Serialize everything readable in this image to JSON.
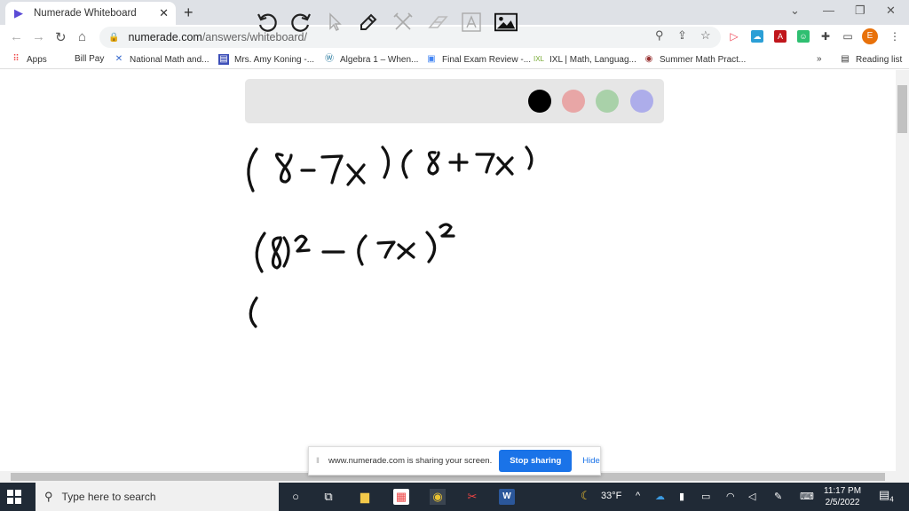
{
  "browser": {
    "tab_title": "Numerade Whiteboard",
    "url_domain": "numerade.com",
    "url_path": "/answers/whiteboard/",
    "avatar_letter": "E",
    "bookmarks": [
      {
        "label": "Apps",
        "icon": "apps-grid-icon"
      },
      {
        "label": "Bill Pay",
        "icon": ""
      },
      {
        "label": "National Math and...",
        "icon": "ribbon-icon"
      },
      {
        "label": "Mrs. Amy Koning -...",
        "icon": "page-icon"
      },
      {
        "label": "Algebra 1 – When...",
        "icon": "wordpress-icon"
      },
      {
        "label": "Final Exam Review -...",
        "icon": "form-icon"
      },
      {
        "label": "IXL | Math, Languag...",
        "icon": "ixl-icon"
      },
      {
        "label": "Summer Math Pract...",
        "icon": "globe-icon"
      }
    ],
    "overflow": "»",
    "reading_list": "Reading list"
  },
  "whiteboard": {
    "tools": [
      "undo",
      "redo",
      "select",
      "pen",
      "tools",
      "eraser",
      "text",
      "image"
    ],
    "colors": [
      "#000000",
      "#e8a6a6",
      "#a9d1a9",
      "#adadea"
    ],
    "handwriting": [
      "(8-7x)(8+7x)",
      "(8)^2 - (7x)^2",
      "("
    ]
  },
  "share_bar": {
    "message": "www.numerade.com is sharing your screen.",
    "stop_label": "Stop sharing",
    "hide_label": "Hide"
  },
  "taskbar": {
    "search_placeholder": "Type here to search",
    "weather": "33°F",
    "time": "11:17 PM",
    "date": "2/5/2022",
    "notifications": "4"
  }
}
